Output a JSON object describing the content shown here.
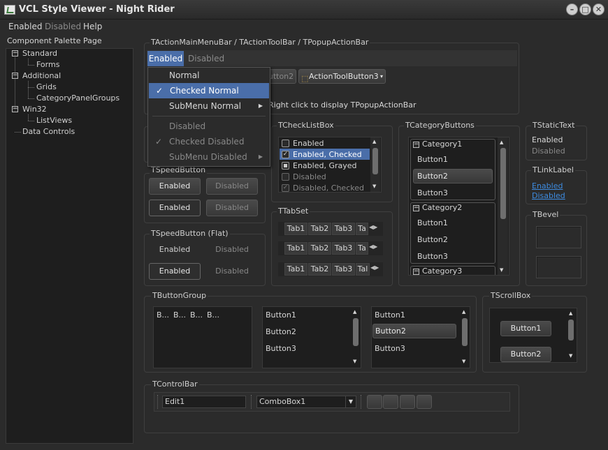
{
  "window": {
    "title": "VCL Style Viewer - Night Rider"
  },
  "menubar": {
    "items": [
      "Enabled",
      "Disabled",
      "Help"
    ]
  },
  "left_panel": {
    "title": "Component Palette Page",
    "tree": [
      {
        "label": "Standard"
      },
      {
        "label": "Forms"
      },
      {
        "label": "Additional"
      },
      {
        "label": "Grids"
      },
      {
        "label": "CategoryPanelGroups"
      },
      {
        "label": "Win32"
      },
      {
        "label": "ListViews"
      },
      {
        "label": "Data Controls"
      }
    ]
  },
  "actionbar": {
    "group_title": "TActionMainMenuBar / TActionToolBar / TPopupActionBar",
    "menu": [
      "Enabled",
      "Disabled"
    ],
    "toolbar_btn_disabled": "utton2",
    "toolbar_btn3": "ActionToolButton3",
    "popup_hint": "Right click to display TPopupActionBar"
  },
  "dropdown": {
    "items": [
      "Normal",
      "Checked Normal",
      "SubMenu Normal",
      "Disabled",
      "Checked Disabled",
      "SubMenu Disabled"
    ]
  },
  "speedbutton": {
    "title": "TSpeedButton",
    "labels": [
      "Enabled",
      "Disabled",
      "Enabled",
      "Disabled"
    ]
  },
  "speedbutton_flat": {
    "title": "TSpeedButton (Flat)",
    "labels": [
      "Enabled",
      "Disabled",
      "Enabled",
      "Disabled"
    ]
  },
  "checklistbox": {
    "title": "TCheckListBox",
    "items": [
      "Enabled",
      "Enabled, Checked",
      "Enabled, Grayed",
      "Disabled",
      "Disabled, Checked"
    ]
  },
  "tabset": {
    "title": "TTabSet",
    "tabs": [
      "Tab1",
      "Tab2",
      "Tab3",
      "Ta",
      "Tab1",
      "Tab2",
      "Tab3",
      "Ta",
      "Tab1",
      "Tab2",
      "Tab3",
      "Tal"
    ]
  },
  "categorybuttons": {
    "title": "TCategoryButtons",
    "cat1": "Category1",
    "cat1_items": [
      "Button1",
      "Button2",
      "Button3"
    ],
    "cat2": "Category2",
    "cat2_items": [
      "Button1",
      "Button2",
      "Button3"
    ],
    "cat3": "Category3"
  },
  "statictext": {
    "title": "TStaticText",
    "enabled": "Enabled",
    "disabled": "Disabled"
  },
  "linklabel": {
    "title": "TLinkLabel",
    "enabled": "Enabled",
    "disabled": "Disabled"
  },
  "bevel": {
    "title": "TBevel"
  },
  "buttongroup": {
    "title": "TButtonGroup",
    "compact": [
      "B...",
      "B...",
      "B...",
      "B..."
    ],
    "list1": [
      "Button1",
      "Button2",
      "Button3"
    ],
    "list2": [
      "Button1",
      "Button2",
      "Button3"
    ]
  },
  "scrollbox": {
    "title": "TScrollBox",
    "buttons": [
      "Button1",
      "Button2"
    ]
  },
  "controlbar": {
    "title": "TControlBar",
    "edit": "Edit1",
    "combo": "ComboBox1"
  },
  "colors": {
    "accent": "#4a6ea9",
    "link": "#3d8be0",
    "bg": "#2b2b2b"
  }
}
